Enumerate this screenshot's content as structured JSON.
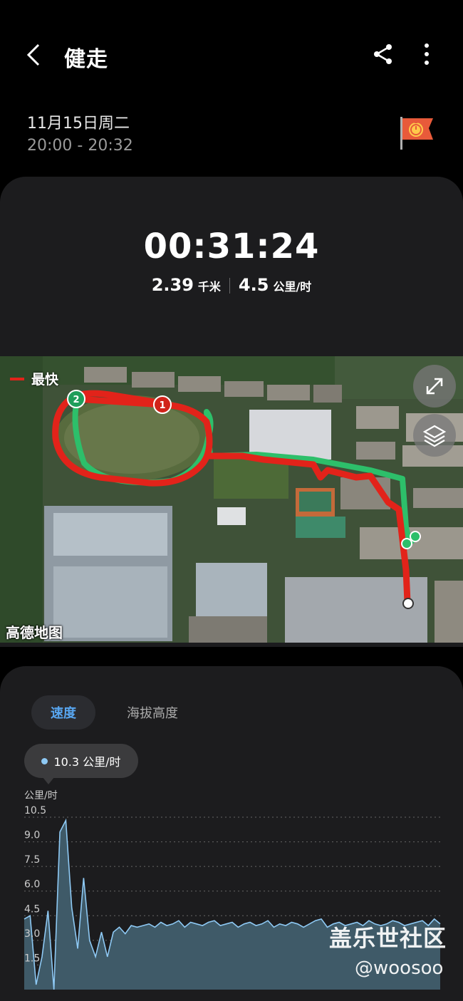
{
  "header": {
    "title": "健走",
    "back_icon": "chevron-left-icon",
    "share_icon": "share-icon",
    "more_icon": "more-vertical-icon"
  },
  "session": {
    "date": "11月15日周二",
    "time_range": "20:00 - 20:32",
    "flag_icon": "stopwatch-flag-icon"
  },
  "summary": {
    "duration": "00:31:24",
    "distance_value": "2.39",
    "distance_unit": "千米",
    "speed_value": "4.5",
    "speed_unit": "公里/时"
  },
  "map": {
    "legend_label": "最快",
    "legend_color": "#e2231a",
    "track_color_normal": "#2dbf6a",
    "track_color_fastest": "#e2231a",
    "markers": [
      "1",
      "2"
    ],
    "attribution": "高德地图",
    "expand_icon": "expand-icon",
    "layers_icon": "layers-icon"
  },
  "chart_tabs": {
    "speed": "速度",
    "altitude": "海拔高度"
  },
  "tooltip": {
    "value": "10.3 公里/时"
  },
  "chart_data": {
    "type": "area",
    "ylabel": "公里/时",
    "yticks": [
      "10.5",
      "9.0",
      "7.5",
      "6.0",
      "4.5",
      "3.0",
      "1.5"
    ],
    "ylim": [
      0,
      10.5
    ],
    "xlim": [
      0,
      31.4
    ],
    "grid": true,
    "series": [
      {
        "values": [
          4.3,
          4.5,
          0.3,
          2.0,
          4.8,
          0.0,
          9.6,
          10.3,
          5.0,
          2.5,
          6.8,
          3.0,
          2.0,
          3.5,
          2.0,
          3.5,
          3.8,
          3.4,
          3.9,
          3.8,
          3.9,
          4.0,
          3.8,
          4.1,
          3.9,
          4.0,
          4.2,
          3.8,
          4.1,
          4.0,
          3.9,
          4.1,
          4.2,
          3.9,
          4.0,
          4.1,
          3.8,
          4.0,
          4.1,
          3.9,
          4.0,
          4.2,
          3.8,
          4.0,
          3.9,
          4.1,
          4.0,
          3.8,
          4.0,
          4.2,
          4.3,
          3.8,
          4.0,
          4.1,
          3.9,
          4.0,
          4.1,
          3.9,
          4.2,
          4.0,
          3.9,
          4.0,
          4.2,
          4.1,
          3.9,
          4.0,
          4.1,
          4.2,
          3.9,
          4.3,
          4.0
        ]
      }
    ],
    "fill_color": "#3f5a68",
    "line_color": "#8ec9f4"
  },
  "watermark": {
    "line1": "盖乐世社区",
    "line2": "@woosoo"
  }
}
